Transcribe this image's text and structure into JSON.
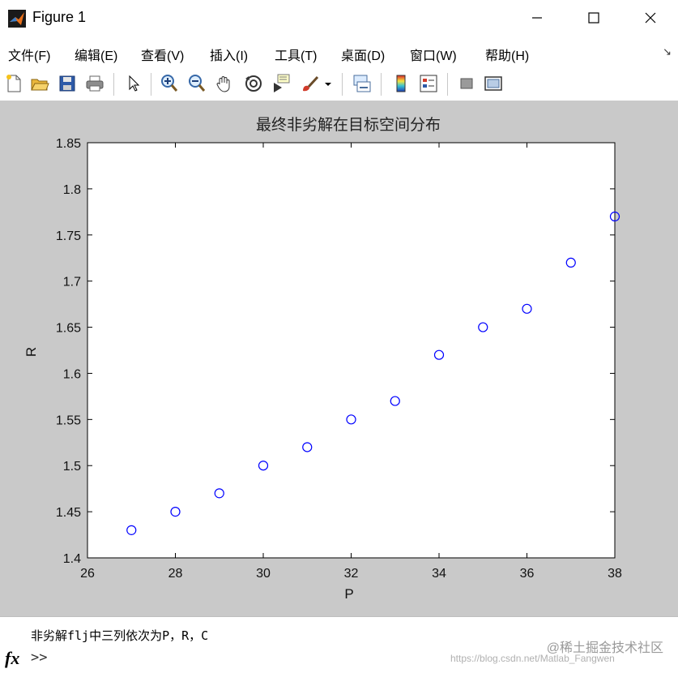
{
  "window": {
    "title": "Figure 1",
    "controls": {
      "minimize": "—",
      "maximize": "☐",
      "close": "✕"
    }
  },
  "menubar": {
    "items": [
      "文件(F)",
      "编辑(E)",
      "查看(V)",
      "插入(I)",
      "工具(T)",
      "桌面(D)",
      "窗口(W)",
      "帮助(H)"
    ],
    "corner_glyph": "↘"
  },
  "toolbar": {
    "buttons": [
      "new-figure-icon",
      "open-folder-icon",
      "save-icon",
      "print-icon",
      "pointer-icon",
      "zoom-in-icon",
      "zoom-out-icon",
      "pan-hand-icon",
      "rotate-3d-icon",
      "data-cursor-icon",
      "brush-icon",
      "brush-dropdown-icon",
      "link-plot-icon",
      "colorbar-icon",
      "legend-icon",
      "hide-plot-tools-icon",
      "show-plot-tools-icon"
    ]
  },
  "chart_data": {
    "type": "scatter",
    "title": "最终非劣解在目标空间分布",
    "xlabel": "P",
    "ylabel": "R",
    "xlim": [
      26,
      38
    ],
    "ylim": [
      1.4,
      1.85
    ],
    "xticks": [
      26,
      28,
      30,
      32,
      34,
      36,
      38
    ],
    "yticks": [
      1.4,
      1.45,
      1.5,
      1.55,
      1.6,
      1.65,
      1.7,
      1.75,
      1.8,
      1.85
    ],
    "x": [
      27,
      28,
      29,
      30,
      31,
      32,
      33,
      34,
      35,
      36,
      37,
      38
    ],
    "y": [
      1.43,
      1.45,
      1.47,
      1.5,
      1.52,
      1.55,
      1.57,
      1.62,
      1.65,
      1.67,
      1.72,
      1.77
    ],
    "marker": "circle-open",
    "marker_color": "#0000ff",
    "grid": false
  },
  "command": {
    "output_line": "非劣解flj中三列依次为P，R，C",
    "fx_label": "fx",
    "prompt": ">>"
  },
  "watermark": {
    "text": "@稀土掘金技术社区",
    "url": "https://blog.csdn.net/Matlab_Fangwen"
  }
}
